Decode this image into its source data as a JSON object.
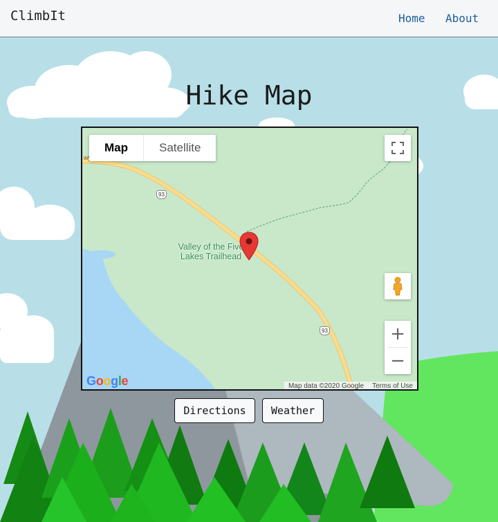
{
  "navbar": {
    "brand": "ClimbIt",
    "links": [
      {
        "label": "Home"
      },
      {
        "label": "About"
      }
    ]
  },
  "page": {
    "title": "Hike Map"
  },
  "map": {
    "type_controls": {
      "map_label": "Map",
      "satellite_label": "Satellite",
      "selected": "Map"
    },
    "place_label_line1": "Valley of the Five",
    "place_label_line2": "Lakes Trailhead",
    "road_number": "93",
    "attribution": "Map data ©2020 Google",
    "terms_label": "Terms of Use",
    "logo_text": "Google",
    "zoom_in_label": "+",
    "zoom_out_label": "−",
    "icons": [
      "fullscreen-icon",
      "pegman-icon",
      "map-marker-icon"
    ]
  },
  "actions": {
    "directions_label": "Directions",
    "weather_label": "Weather"
  },
  "colors": {
    "sky": "#b8dfe8",
    "map_land": "#c9e8c9",
    "water": "#a8d6f5",
    "road": "#f9dc8c",
    "marker": "#e53935",
    "link": "#1f5d9b",
    "grass": "#63e65f",
    "mountain": "#8e979e"
  }
}
